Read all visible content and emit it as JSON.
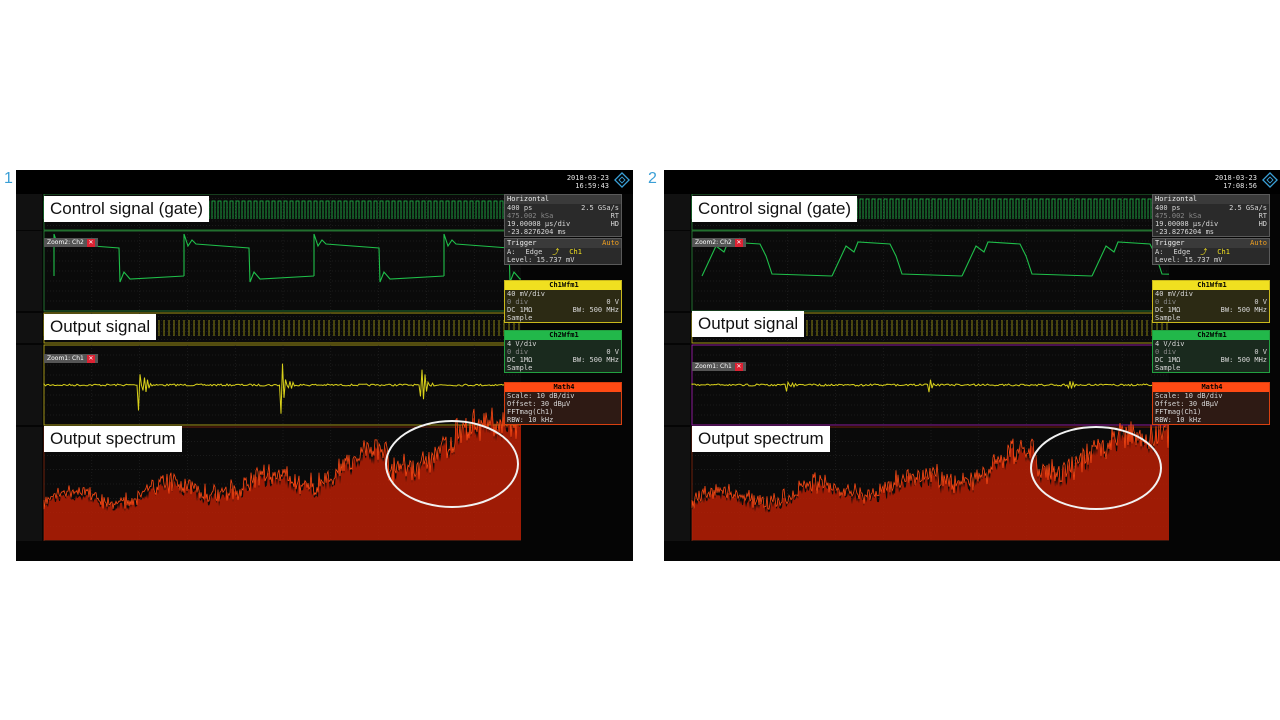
{
  "panels": [
    {
      "number": "1",
      "date": "2018-03-23",
      "time": "16:59:43",
      "callouts": {
        "control": "Control signal (gate)",
        "output": "Output signal",
        "spectrum": "Output spectrum"
      },
      "zoom_tags": [
        "Zoom2: Ch2",
        "Zoom1: Ch1"
      ],
      "horizontal": {
        "title": "Horizontal",
        "res": "400 ps",
        "rate": "2.5 GSa/s",
        "points": "475.002 kSa",
        "mode": "RT",
        "scale": "19.00008 µs/div",
        "hd": "HD",
        "position": "-23.8276204 ms"
      },
      "trigger": {
        "title": "Trigger",
        "mode": "Auto",
        "src_label": "A:",
        "edge": "Edge",
        "channel": "Ch1",
        "level": "Level: 15.737 mV"
      },
      "ch1": {
        "title": "Ch1Wfm1",
        "scale": "40 mV/div",
        "offset_l": "0 div",
        "offset_r": "0 V",
        "coupling": "DC 1MΩ",
        "bw": "BW: 500 MHz",
        "acq": "Sample"
      },
      "ch2": {
        "title": "Ch2Wfm1",
        "scale": "4 V/div",
        "offset_l": "0 div",
        "offset_r": "0 V",
        "coupling": "DC 1MΩ",
        "bw": "BW: 500 MHz",
        "acq": "Sample"
      },
      "math": {
        "title": "Math4",
        "scale": "Scale: 10 dB/div",
        "offset": "Offset: 30 dBµV",
        "func": "FFTmag(Ch1)",
        "rbw": "RBW: 10 kHz"
      },
      "traces": {
        "gate_style": "square",
        "output_amplitude": 1.0,
        "spectrum_peak": 1.0
      }
    },
    {
      "number": "2",
      "date": "2018-03-23",
      "time": "17:08:56",
      "callouts": {
        "control": "Control signal (gate)",
        "output": "Output signal",
        "spectrum": "Output spectrum"
      },
      "zoom_tags": [
        "Zoom2: Ch2",
        "Zoom1: Ch1"
      ],
      "horizontal": {
        "title": "Horizontal",
        "res": "400 ps",
        "rate": "2.5 GSa/s",
        "points": "475.002 kSa",
        "mode": "RT",
        "scale": "19.00008 µs/div",
        "hd": "HD",
        "position": "-23.8276204 ms"
      },
      "trigger": {
        "title": "Trigger",
        "mode": "Auto",
        "src_label": "A:",
        "edge": "Edge",
        "channel": "Ch1",
        "level": "Level: 15.737 mV"
      },
      "ch1": {
        "title": "Ch1Wfm1",
        "scale": "40 mV/div",
        "offset_l": "0 div",
        "offset_r": "0 V",
        "coupling": "DC 1MΩ",
        "bw": "BW: 500 MHz",
        "acq": "Sample"
      },
      "ch2": {
        "title": "Ch2Wfm1",
        "scale": "4 V/div",
        "offset_l": "0 div",
        "offset_r": "0 V",
        "coupling": "DC 1MΩ",
        "bw": "BW: 500 MHz",
        "acq": "Sample"
      },
      "math": {
        "title": "Math4",
        "scale": "Scale: 10 dB/div",
        "offset": "Offset: 30 dBµV",
        "func": "FFTmag(Ch1)",
        "rbw": "RBW: 10 kHz"
      },
      "traces": {
        "gate_style": "trapezoid",
        "output_amplitude": 0.25,
        "spectrum_peak": 0.72
      }
    }
  ],
  "colors": {
    "gate": "#1fbf4a",
    "output": "#d8d01a",
    "spectrum": "#ff4a14",
    "spectrum_dark": "#b81e05",
    "ch1_header": "#f0e020",
    "ch2_header": "#22b84a",
    "math_header": "#ff4a14"
  },
  "icons": {
    "logo": "rs-diamond-logo"
  }
}
